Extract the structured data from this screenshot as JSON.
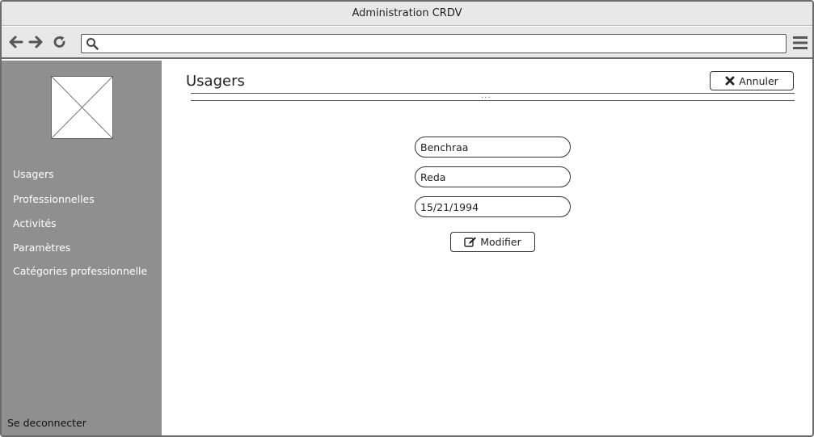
{
  "window": {
    "title": "Administration CRDV"
  },
  "browser": {
    "url_value": "",
    "icons": {
      "back": "arrow-left-icon",
      "forward": "arrow-right-icon",
      "reload": "reload-icon",
      "search": "search-icon",
      "menu": "hamburger-menu-icon"
    }
  },
  "sidebar": {
    "logo": "image-placeholder",
    "items": [
      {
        "label": "Usagers"
      },
      {
        "label": "Professionnelles"
      },
      {
        "label": "Activités"
      },
      {
        "label": "Paramètres"
      },
      {
        "label": "Catégories professionnelle"
      }
    ],
    "logout_label": "Se deconnecter"
  },
  "main": {
    "title": "Usagers",
    "cancel_label": "Annuler",
    "divider_handle": "...",
    "form": {
      "last_name": "Benchraa",
      "first_name": "Reda",
      "birth_date": "15/21/1994"
    },
    "modify_label": "Modifier"
  },
  "colors": {
    "sidebar": "#8f8f8f",
    "chrome": "#e8e8e8",
    "border": "#6b6b6b"
  }
}
